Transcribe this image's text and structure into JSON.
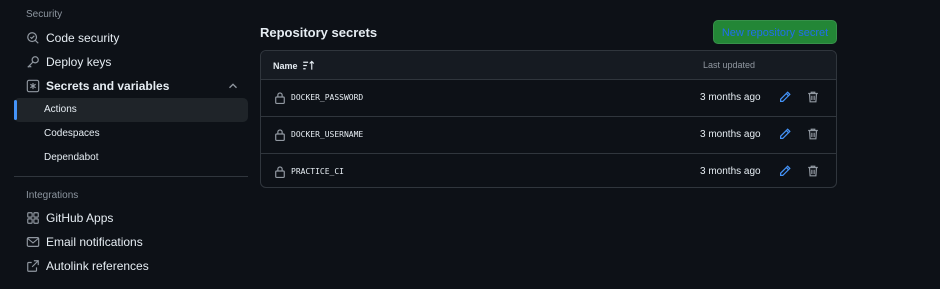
{
  "sidebar": {
    "security_heading": "Security",
    "security_items": [
      {
        "label": "Code security",
        "icon": "shield-search-icon"
      },
      {
        "label": "Deploy keys",
        "icon": "key-icon"
      },
      {
        "label": "Secrets and variables",
        "icon": "asterisk-box-icon"
      }
    ],
    "sub_items": [
      {
        "label": "Actions",
        "active": true
      },
      {
        "label": "Codespaces",
        "active": false
      },
      {
        "label": "Dependabot",
        "active": false
      }
    ],
    "integrations_heading": "Integrations",
    "integration_items": [
      {
        "label": "GitHub Apps",
        "icon": "apps-icon"
      },
      {
        "label": "Email notifications",
        "icon": "mail-icon"
      },
      {
        "label": "Autolink references",
        "icon": "autolink-icon"
      }
    ]
  },
  "main": {
    "title": "Repository secrets",
    "new_button_label": "New repository secret",
    "table": {
      "col_name": "Name",
      "col_updated": "Last updated",
      "rows": [
        {
          "name": "DOCKER_PASSWORD",
          "updated": "3 months ago"
        },
        {
          "name": "DOCKER_USERNAME",
          "updated": "3 months ago"
        },
        {
          "name": "PRACTICE_CI",
          "updated": "3 months ago"
        }
      ]
    }
  },
  "colors": {
    "background": "#0d1117",
    "accent_blue": "#4493f8",
    "button_green": "#238636",
    "border": "#30363d"
  }
}
